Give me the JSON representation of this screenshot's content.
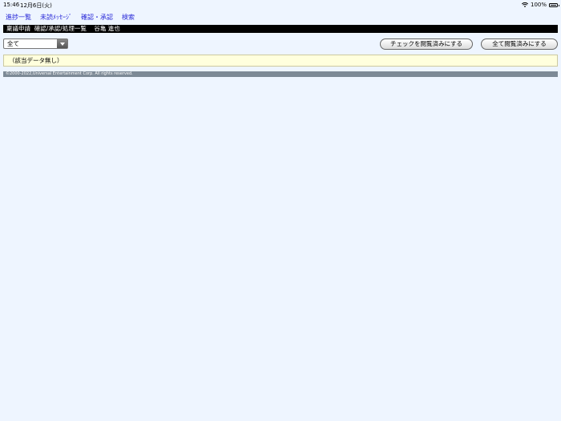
{
  "status_bar": {
    "time": "15:46",
    "date": "12月6日(火)",
    "battery_percent": "100%",
    "battery_level": 1.0
  },
  "nav": {
    "items": [
      {
        "label": "進捗一覧"
      },
      {
        "label": "未読ﾒｯｾｰｼﾞ"
      },
      {
        "label": "確認・承認"
      },
      {
        "label": "検索"
      }
    ]
  },
  "header": {
    "title": "稟議申請  確認/承認/処理一覧    谷亀 進也"
  },
  "filter": {
    "selected": "全て"
  },
  "actions": {
    "mark_checked_read": "チェックを閲覧済みにする",
    "mark_all_read": "全て閲覧済みにする"
  },
  "main": {
    "empty_message": "（該当データ無し）"
  },
  "footer": {
    "copyright": "©2000-2022,Universal Entertainment Corp. All rights reserved."
  },
  "colors": {
    "background": "#eef5ff",
    "nav_link": "#2a2ad8",
    "title_bar": "#000000",
    "notice_bg": "#ffffdd",
    "footer_bg": "#7d8a96"
  }
}
